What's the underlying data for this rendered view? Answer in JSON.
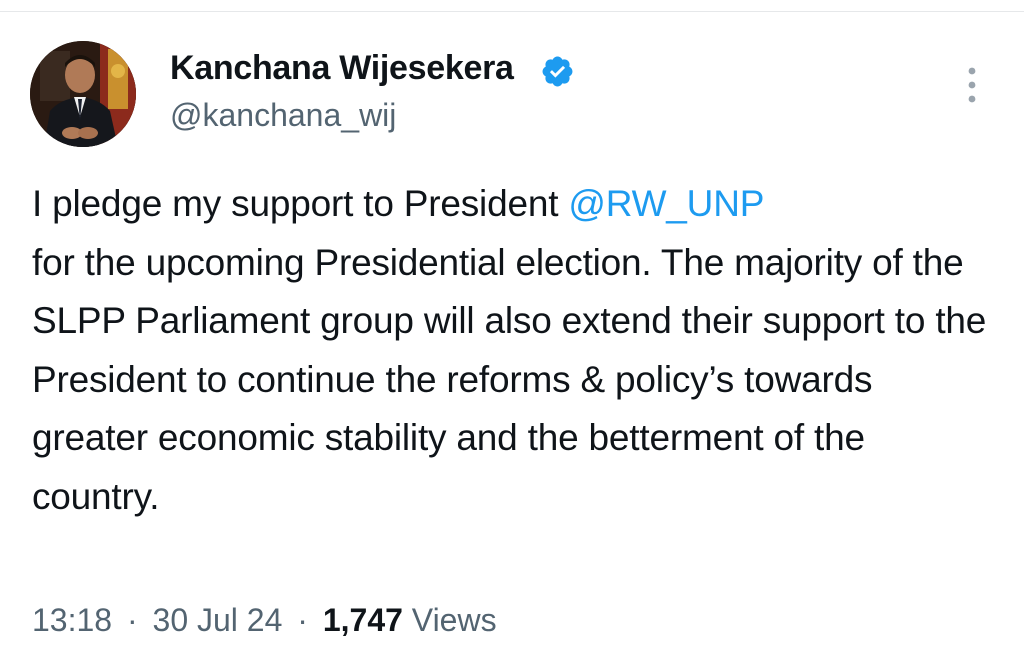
{
  "author": {
    "display_name": "Kanchana Wijesekera",
    "handle": "@kanchana_wij",
    "verified_icon": "verified-badge-icon",
    "avatar_icon": "profile-photo"
  },
  "more_icon": "vertical-ellipsis-icon",
  "tweet": {
    "text_before_mention": "I pledge my support to President ",
    "mention": "@RW_UNP",
    "text_after_mention": " for the upcoming Presidential election. The majority of the SLPP Parliament group will also extend their support to the President to continue the reforms & policy’s towards greater economic stability and the betterment of the country."
  },
  "meta": {
    "time": "13:18",
    "separator": "·",
    "date": "30 Jul 24",
    "views_count": "1,747",
    "views_label": "Views"
  },
  "colors": {
    "text": "#0f1419",
    "secondary": "#536471",
    "accent": "#1d9bf0"
  }
}
